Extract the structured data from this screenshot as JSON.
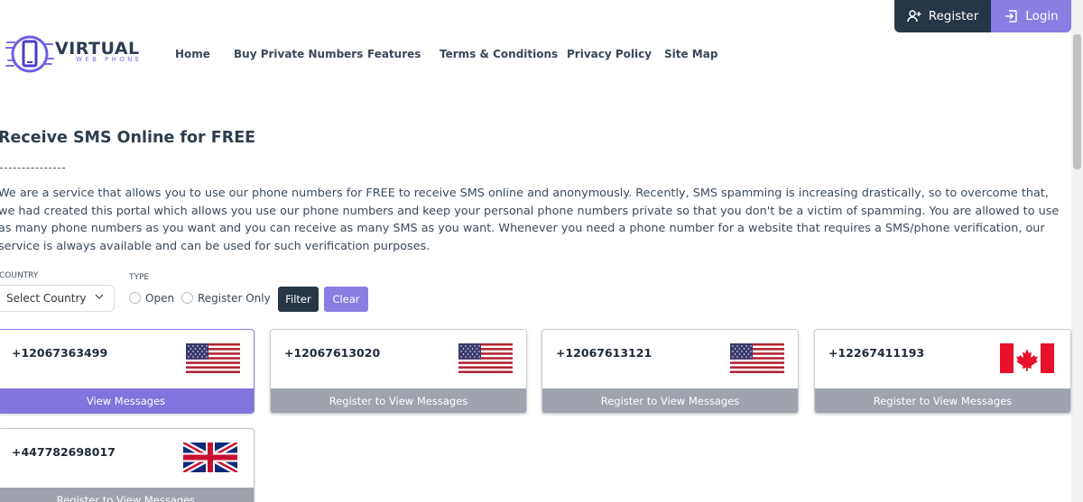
{
  "brand": {
    "name": "VIRTUAL",
    "tagline": "WEB PHONE"
  },
  "nav": [
    {
      "label": "Home"
    },
    {
      "label": "Buy Private Numbers"
    },
    {
      "label": "Features"
    },
    {
      "label": "Terms & Conditions"
    },
    {
      "label": "Privacy Policy"
    },
    {
      "label": "Site Map"
    }
  ],
  "auth": {
    "register": "Register",
    "login": "Login"
  },
  "page": {
    "title": "Receive SMS Online for FREE",
    "intro": "We are a service that allows you to use our phone numbers for FREE to receive SMS online and anonymously. Recently, SMS spamming is increasing drastically, so to overcome that, we had created this portal which allows you use our phone numbers and keep your personal phone numbers private so that you don't be a victim of spamming. You are allowed to use as many phone numbers as you want and you can receive as many SMS as you want. Whenever you need a phone number for a website that requires a SMS/phone verification, our service is always available and can be used for such verification purposes."
  },
  "filters": {
    "country_label": "COUNTRY",
    "country_value": "Select Country",
    "type_label": "TYPE",
    "type_options": [
      "Open",
      "Register Only"
    ],
    "filter_button": "Filter",
    "clear_button": "Clear"
  },
  "numbers": [
    {
      "number": "+12067363499",
      "country": "us",
      "action": "View Messages",
      "open": true
    },
    {
      "number": "+12067613020",
      "country": "us",
      "action": "Register to View Messages",
      "open": false
    },
    {
      "number": "+12067613121",
      "country": "us",
      "action": "Register to View Messages",
      "open": false
    },
    {
      "number": "+12267411193",
      "country": "ca",
      "action": "Register to View Messages",
      "open": false
    },
    {
      "number": "+447782698017",
      "country": "gb",
      "action": "Register to View Messages",
      "open": false
    }
  ],
  "colors": {
    "accent": "#8b7ee3",
    "dark": "#263645",
    "locked_action": "#9ea3ad"
  }
}
